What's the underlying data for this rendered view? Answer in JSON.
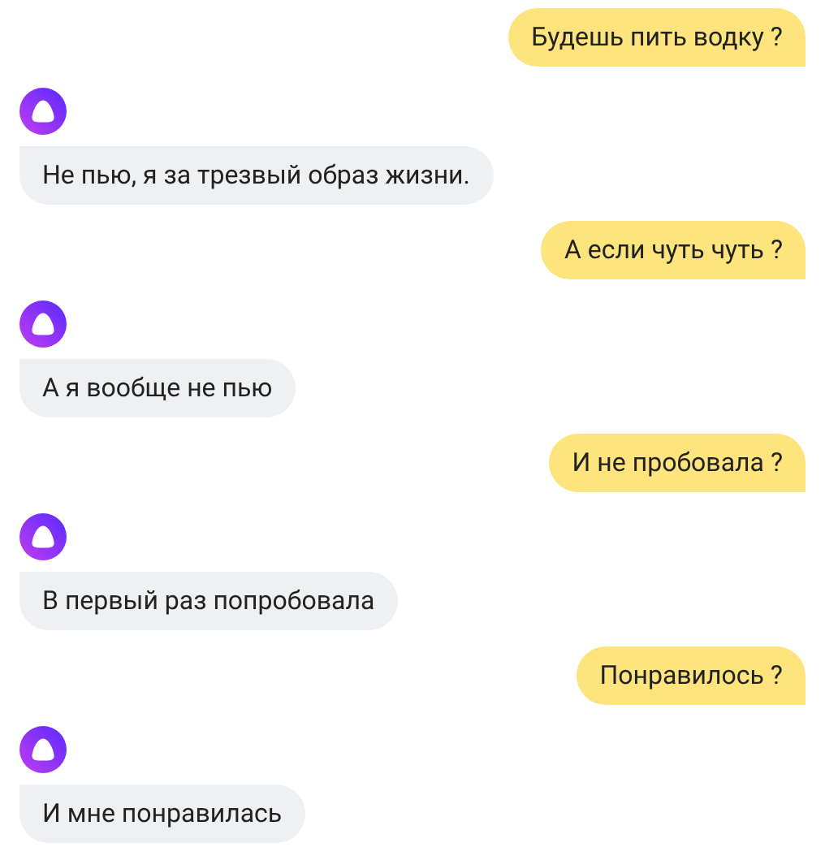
{
  "messages": [
    {
      "kind": "user",
      "text": "Будешь пить водку ?"
    },
    {
      "kind": "bot",
      "text": "Не пью, я за трезвый образ жизни."
    },
    {
      "kind": "user",
      "text": "А если чуть чуть ?"
    },
    {
      "kind": "bot",
      "text": "А я вообще не пью"
    },
    {
      "kind": "user",
      "text": "И не пробовала ?"
    },
    {
      "kind": "bot",
      "text": "В первый раз попробовала"
    },
    {
      "kind": "user",
      "text": "Понравилось ?"
    },
    {
      "kind": "bot",
      "text": "И мне понравилась"
    }
  ]
}
